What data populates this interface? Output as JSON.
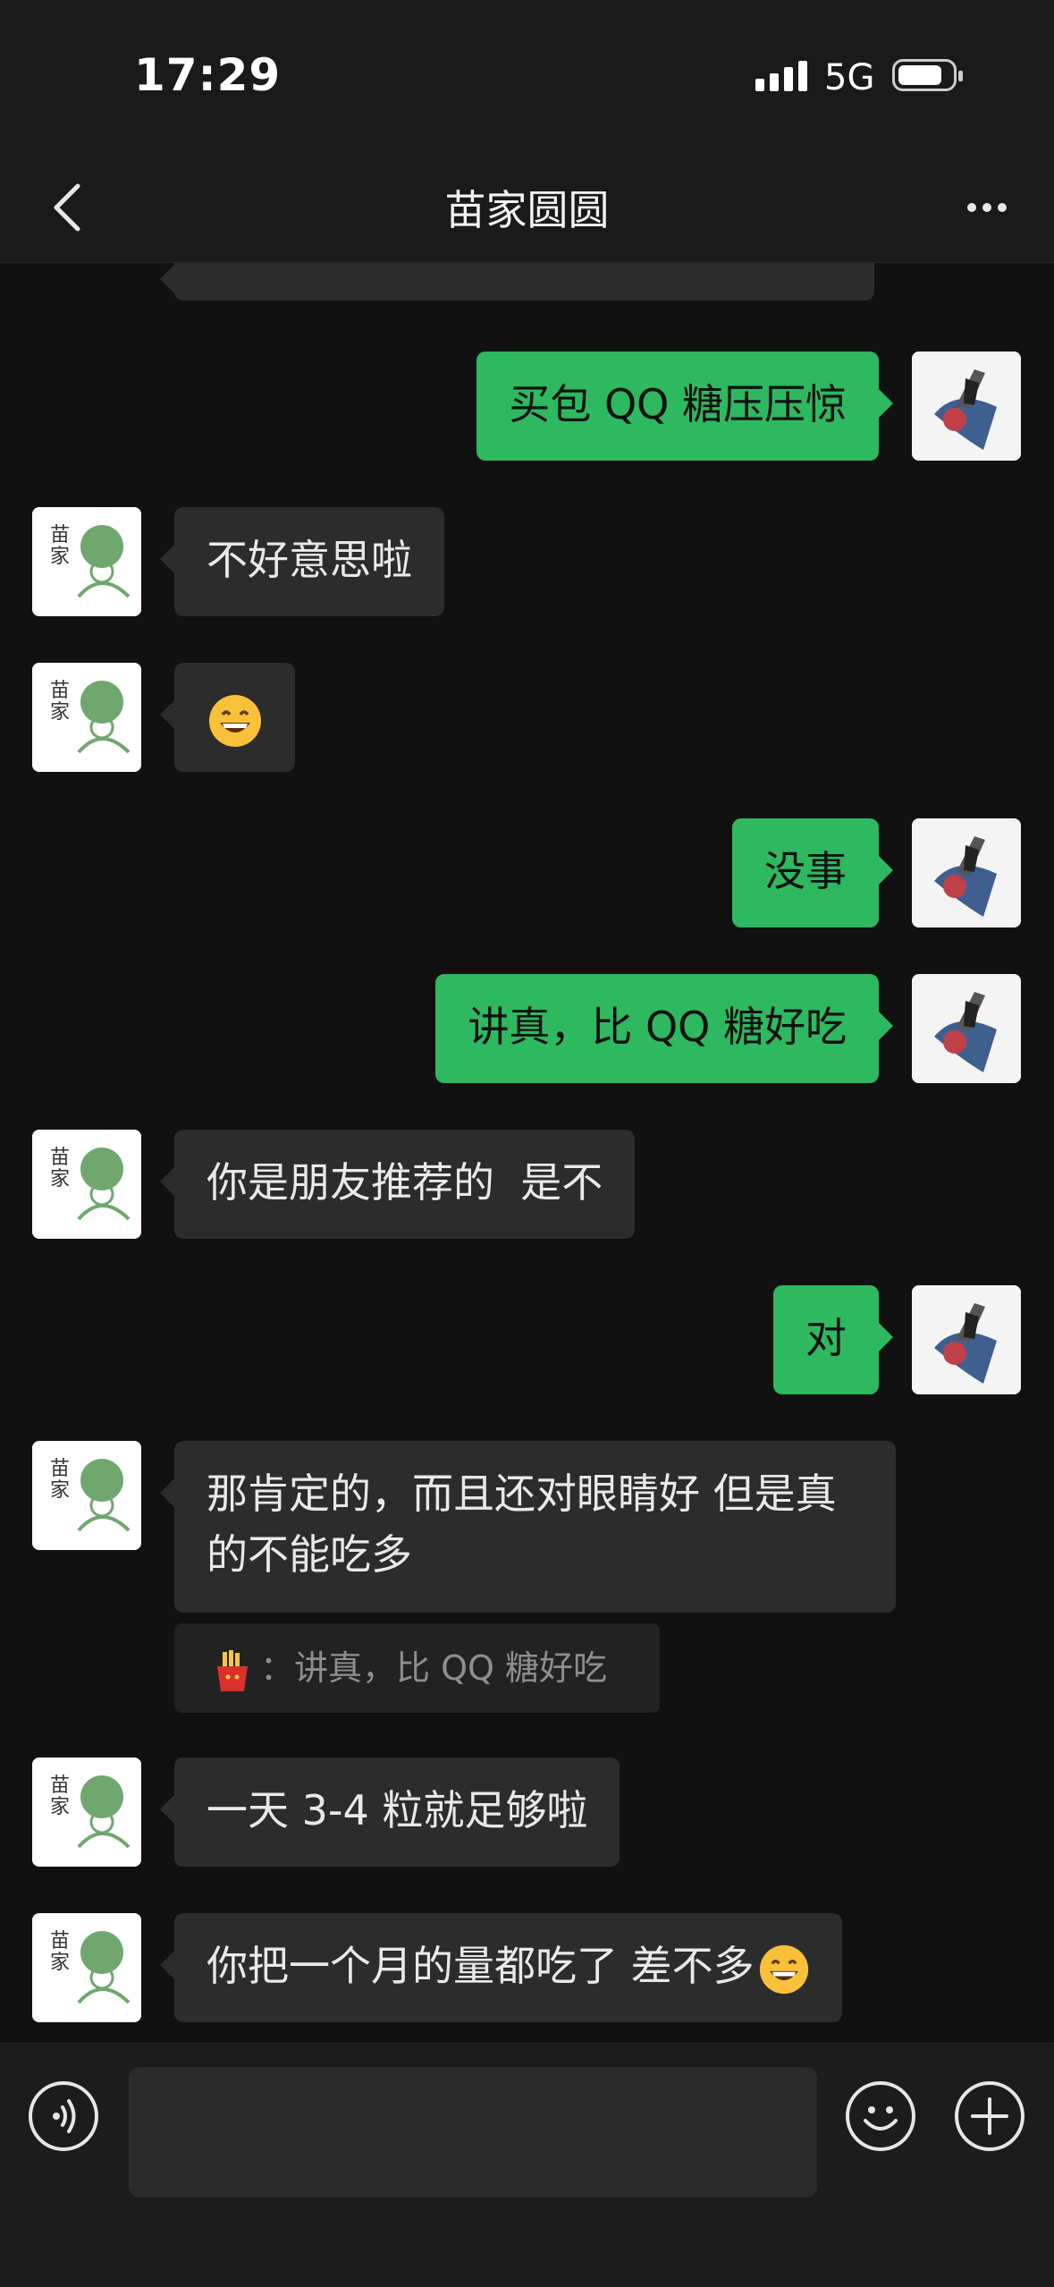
{
  "status_bar": {
    "time": "17:29",
    "network": "5G"
  },
  "header": {
    "title": "苗家圆圆"
  },
  "messages": [
    {
      "from": "me",
      "text": "买包 QQ 糖压压惊"
    },
    {
      "from": "contact",
      "text": "不好意思啦"
    },
    {
      "from": "contact",
      "emoji": "grinning-face-emoji"
    },
    {
      "from": "me",
      "text": "没事"
    },
    {
      "from": "me",
      "text": "讲真，比 QQ 糖好吃"
    },
    {
      "from": "contact",
      "text": "你是朋友推荐的  是不"
    },
    {
      "from": "me",
      "text": "对"
    },
    {
      "from": "contact",
      "text": "那肯定的，而且还对眼睛好  但是真的不能吃多",
      "quote": {
        "emoji": "fries-emoji",
        "sep": "：",
        "text": "讲真，比 QQ 糖好吃"
      }
    },
    {
      "from": "contact",
      "text": "一天 3-4 粒就足够啦"
    },
    {
      "from": "contact",
      "text": "你把一个月的量都吃了 差不多",
      "emoji": "grinning-face-emoji"
    }
  ],
  "icons": {
    "back": "chevron-left-icon",
    "more": "more-dots-icon",
    "voice": "voice-icon",
    "emoji": "smiley-icon",
    "plus": "plus-icon"
  },
  "colors": {
    "outgoing_bubble": "#2eb860",
    "incoming_bubble": "#2c2c2c",
    "background": "#111111"
  }
}
